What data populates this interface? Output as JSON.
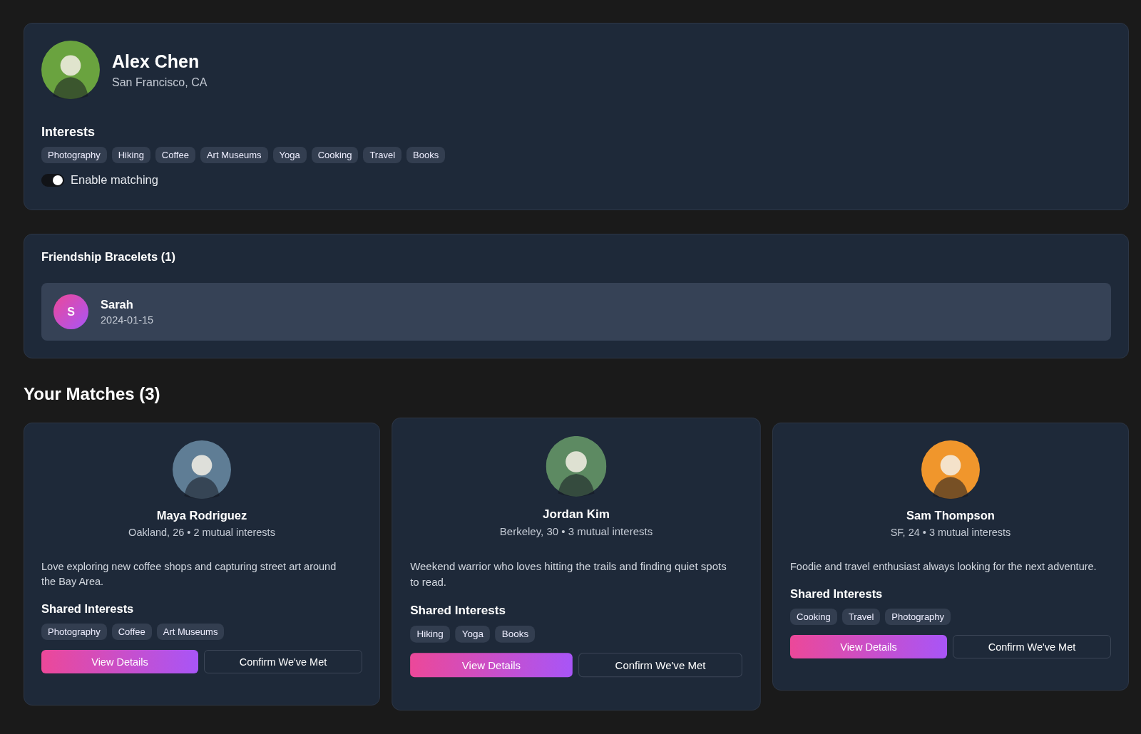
{
  "profile": {
    "name": "Alex Chen",
    "location": "San Francisco, CA",
    "interests_title": "Interests",
    "interests": [
      "Photography",
      "Hiking",
      "Coffee",
      "Art Museums",
      "Yoga",
      "Cooking",
      "Travel",
      "Books"
    ],
    "matching": {
      "label": "Enable matching",
      "on": true
    }
  },
  "bracelets": {
    "title": "Friendship Bracelets (1)",
    "items": [
      {
        "initial": "S",
        "name": "Sarah",
        "date": "2024-01-15"
      }
    ]
  },
  "matches": {
    "title": "Your Matches (3)",
    "items": [
      {
        "name": "Maya Rodriguez",
        "meta": "Oakland, 26 • 2 mutual interests",
        "bio": "Love exploring new coffee shops and capturing street art around the Bay Area.",
        "shared_title": "Shared Interests",
        "shared": [
          "Photography",
          "Coffee",
          "Art Museums"
        ],
        "primary": "View Details",
        "secondary": "Confirm We've Met",
        "color": "#5f7d95",
        "hovered": false
      },
      {
        "name": "Jordan Kim",
        "meta": "Berkeley, 30 • 3 mutual interests",
        "bio": "Weekend warrior who loves hitting the trails and finding quiet spots to read.",
        "shared_title": "Shared Interests",
        "shared": [
          "Hiking",
          "Yoga",
          "Books"
        ],
        "primary": "View Details",
        "secondary": "Confirm We've Met",
        "color": "#5d8a62",
        "hovered": true
      },
      {
        "name": "Sam Thompson",
        "meta": "SF, 24 • 3 mutual interests",
        "bio": "Foodie and travel enthusiast always looking for the next adventure.",
        "shared_title": "Shared Interests",
        "shared": [
          "Cooking",
          "Travel",
          "Photography"
        ],
        "primary": "View Details",
        "secondary": "Confirm We've Met",
        "color": "#f0962c",
        "hovered": false
      }
    ]
  }
}
